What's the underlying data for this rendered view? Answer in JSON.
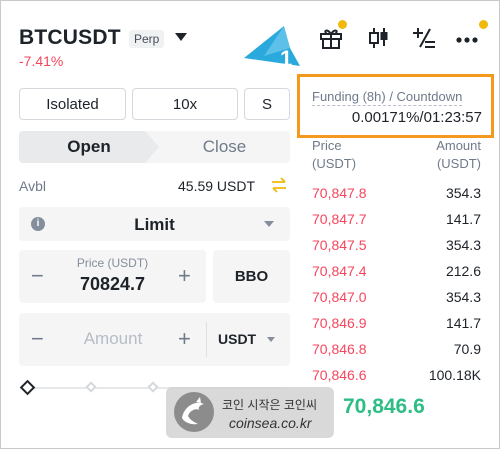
{
  "header": {
    "symbol": "BTCUSDT",
    "contract_type": "Perp",
    "change": "-7.41%"
  },
  "toolbar_icons": [
    "gift-icon",
    "candlestick-chart-icon",
    "calculator-icon",
    "more-icon"
  ],
  "annotation": {
    "badge_number": "1"
  },
  "funding": {
    "label": "Funding (8h) / Countdown",
    "value": "0.00171%/01:23:57"
  },
  "margin": {
    "mode": "Isolated",
    "leverage": "10x",
    "asset_mode": "S"
  },
  "tabs": {
    "open": "Open",
    "close": "Close"
  },
  "available": {
    "label": "Avbl",
    "value": "45.59 USDT"
  },
  "order_type": {
    "selected": "Limit"
  },
  "price_input": {
    "label": "Price (USDT)",
    "value": "70824.7",
    "minus": "−",
    "plus": "+"
  },
  "bbo": {
    "label": "BBO"
  },
  "amount_input": {
    "placeholder": "Amount",
    "unit": "USDT",
    "minus": "−",
    "plus": "+"
  },
  "order_book": {
    "price_header_1": "Price",
    "price_header_2": "(USDT)",
    "amount_header_1": "Amount",
    "amount_header_2": "(USDT)",
    "asks": [
      {
        "price": "70,847.8",
        "amount": "354.3"
      },
      {
        "price": "70,847.7",
        "amount": "141.7"
      },
      {
        "price": "70,847.5",
        "amount": "354.3"
      },
      {
        "price": "70,847.4",
        "amount": "212.6"
      },
      {
        "price": "70,847.0",
        "amount": "354.3"
      },
      {
        "price": "70,846.9",
        "amount": "141.7"
      },
      {
        "price": "70,846.8",
        "amount": "70.9"
      },
      {
        "price": "70,846.6",
        "amount": "100.18K"
      }
    ],
    "last_price": "70,846.6"
  },
  "watermark": {
    "title": "코인 시작은 코인씨",
    "url": "coinsea.co.kr"
  },
  "colors": {
    "ask_red": "#f6465d",
    "bid_green": "#2ebd85",
    "accent_yellow": "#f0b90b",
    "annotation_orange": "#f39a1e",
    "callout_blue": "#29a9dc"
  }
}
